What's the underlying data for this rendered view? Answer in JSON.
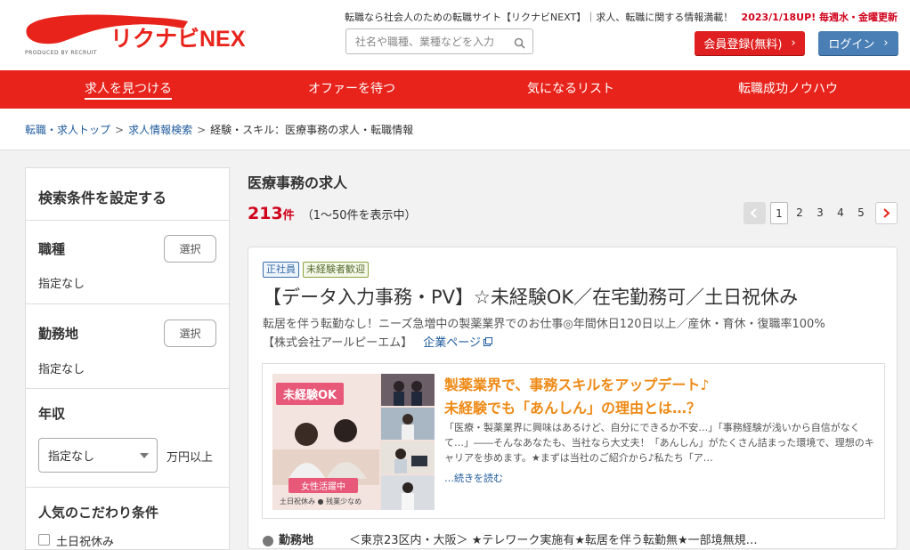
{
  "header": {
    "logo_text": "リクナビNEXT",
    "logo_sub": "PRODUCED BY RECRUIT",
    "tagline": "転職なら社会人のための転職サイト【リクナビNEXT】｜求人、転職に関する情報満載！",
    "update": "2023/1/18UP! 毎週水・金曜更新",
    "search_placeholder": "社名や職種、業種などを入力",
    "register_label": "会員登録(無料)",
    "login_label": "ログイン",
    "brand_color": "#e8231b"
  },
  "nav": {
    "items": [
      {
        "label": "求人を見つける",
        "active": true
      },
      {
        "label": "オファーを待つ"
      },
      {
        "label": "気になるリスト"
      },
      {
        "label": "転職成功ノウハウ"
      }
    ]
  },
  "breadcrumb": {
    "items": [
      "転職・求人トップ",
      "求人情報検索"
    ],
    "current": "経験・スキル：医療事務の求人・転職情報"
  },
  "sidebar": {
    "title": "検索条件を設定する",
    "job_type": {
      "label": "職種",
      "button": "選択",
      "value": "指定なし"
    },
    "location": {
      "label": "勤務地",
      "button": "選択",
      "value": "指定なし"
    },
    "salary": {
      "label": "年収",
      "selected": "指定なし",
      "unit": "万円以上"
    },
    "popular": {
      "label": "人気のこだわり条件",
      "first_option": "土日祝休み"
    }
  },
  "main": {
    "heading": "医療事務の求人",
    "count": "213",
    "count_unit": "件",
    "range": "（1〜50件を表示中）",
    "pages": [
      "1",
      "2",
      "3",
      "4",
      "5"
    ],
    "current_page": "1"
  },
  "job": {
    "tags": [
      "正社員",
      "未経験者歓迎"
    ],
    "title": "【データ入力事務・PV】☆未経験OK／在宅勤務可／土日祝休み",
    "subtitle": "転居を伴う転勤なし！ニーズ急増中の製薬業界でのお仕事◎年間休日120日以上／産休・育休・復職率100%",
    "company": "【株式会社アールピーエム】",
    "company_link": "企業ページ",
    "feature": {
      "badge": "未経験OK",
      "ribbon": "女性活躍中",
      "photo_footer": "土日祝休み ● 残業少なめ",
      "title1": "製薬業界で、事務スキルをアップデート♪",
      "title2": "未経験でも「あんしん」の理由とは…？",
      "body": "「医療・製薬業界に興味はあるけど、自分にできるか不安…」「事務経験が浅いから自信がなくて…」――そんなあなたも、当社なら大丈夫！「あんしん」がたくさん詰まった環境で、理想のキャリアを歩めます。★まずは当社のご紹介から♪私たち「ア…",
      "more": "…続きを読む"
    },
    "location_label": "勤務地",
    "location_value": "＜東京23区内・大阪＞ ★テレワーク実施有★転居を伴う転勤無★一部境無規…"
  }
}
